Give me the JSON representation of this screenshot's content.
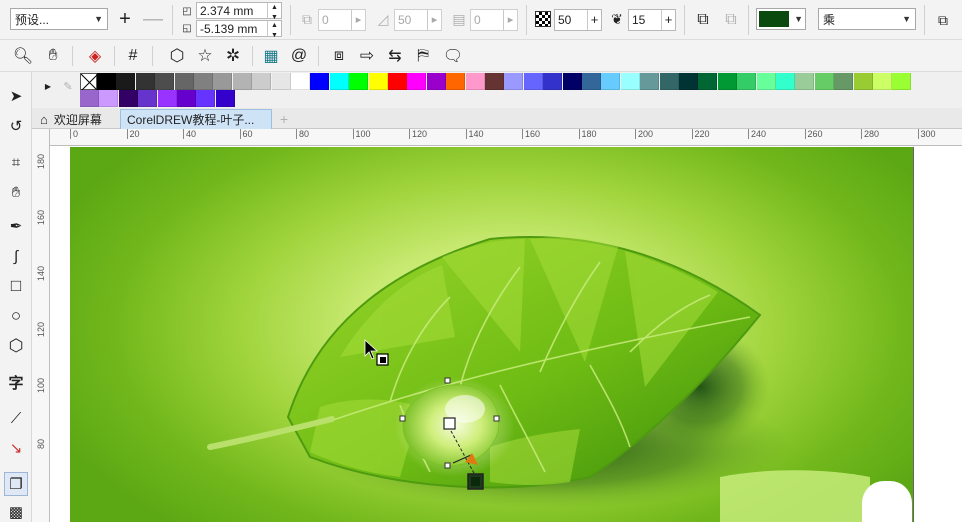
{
  "property_bar": {
    "preset": "预设...",
    "x_value": "2.374 mm",
    "y_value": "-5.139 mm",
    "field1": "0",
    "field2": "50",
    "field3": "0",
    "transparency": "50",
    "feather": "15",
    "color": "#0b4a0e",
    "merge_mode": "乘"
  },
  "tabs": [
    {
      "label": "欢迎屏幕"
    },
    {
      "label": "CorelDREW教程-叶子..."
    }
  ],
  "ruler": {
    "h_ticks": [
      "0",
      "20",
      "40",
      "60",
      "80",
      "100",
      "120",
      "140",
      "160",
      "180",
      "200",
      "220",
      "240",
      "260",
      "280",
      "300"
    ],
    "v_ticks": [
      "180",
      "160",
      "140",
      "120",
      "100",
      "80"
    ]
  },
  "palette": {
    "row1": [
      "#000000",
      "#1a1a1a",
      "#333333",
      "#4d4d4d",
      "#666666",
      "#808080",
      "#999999",
      "#b3b3b3",
      "#cccccc",
      "#e6e6e6",
      "#ffffff",
      "#0000ff",
      "#00ffff",
      "#00ff00",
      "#ffff00",
      "#ff0000",
      "#ff00ff",
      "#9900cc",
      "#ff6600",
      "#ff99cc",
      "#663333",
      "#9999ff",
      "#6666ff",
      "#3333cc",
      "#000066",
      "#336699",
      "#66ccff",
      "#99ffff",
      "#669999",
      "#336666",
      "#003333",
      "#006633",
      "#009933",
      "#33cc66",
      "#66ff99",
      "#33ffcc",
      "#99cc99",
      "#66cc66",
      "#669966",
      "#99cc33",
      "#ccff66",
      "#99ff33"
    ],
    "row2": [
      "#9966cc",
      "#cc99ff",
      "#330066",
      "#6633cc",
      "#9933ff",
      "#6600cc",
      "#6633ff",
      "#3300cc"
    ]
  },
  "icons": {
    "toolbar": [
      "zoom-icon",
      "hand-icon",
      "fill-icon",
      "grid-icon",
      "polygon-icon",
      "star-icon",
      "complex-star-icon",
      "table-icon",
      "spiral-icon",
      "shapes-icon",
      "arrow-shape-icon",
      "flowchart-icon",
      "banner-icon",
      "callout-icon"
    ],
    "toolbox": [
      "pick-tool-icon",
      "shape-tool-icon",
      "crop-tool-icon",
      "pan-tool-icon",
      "freehand-tool-icon",
      "artistic-media-icon",
      "rectangle-tool-icon",
      "ellipse-tool-icon",
      "polygon-tool-icon",
      "text-tool-icon",
      "dimension-tool-icon",
      "connector-tool-icon",
      "shadow-tool-icon",
      "transparency-tool-icon"
    ]
  }
}
